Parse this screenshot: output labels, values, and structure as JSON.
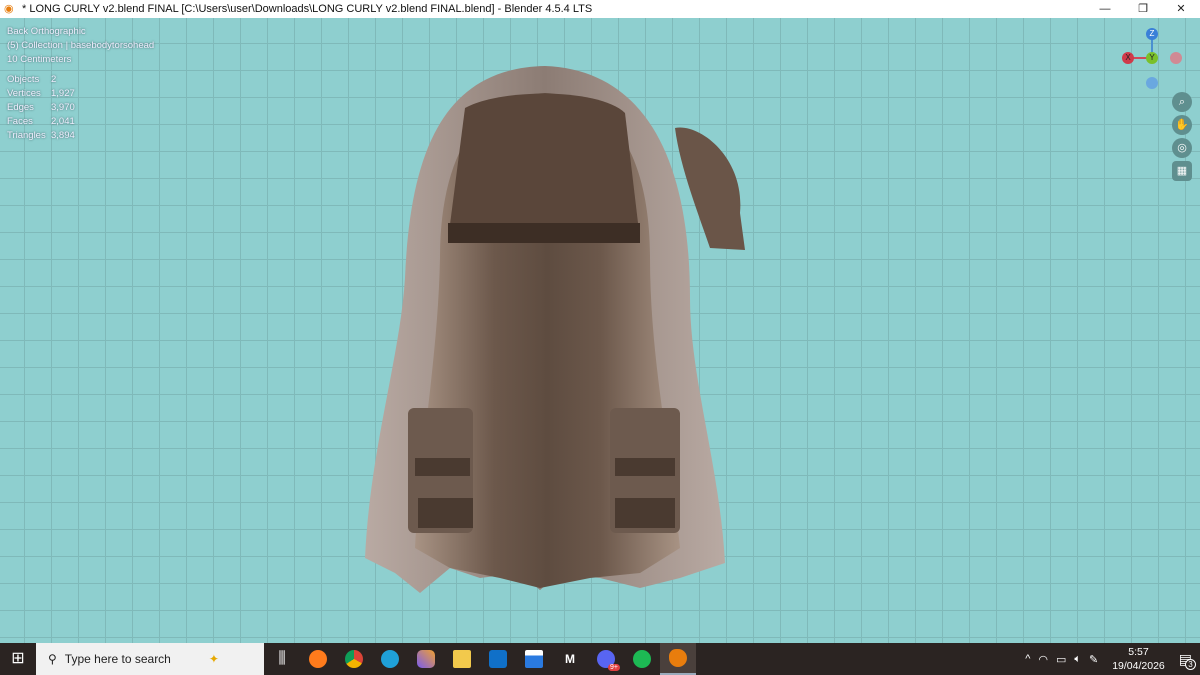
{
  "window": {
    "title": "* LONG CURLY v2.blend FINAL [C:\\Users\\user\\Downloads\\LONG CURLY v2.blend FINAL.blend] - Blender 4.5.4 LTS",
    "minimize": "—",
    "restore": "❐",
    "close": "✕"
  },
  "overlay": {
    "view": "Back Orthographic",
    "collection": "(5) Collection | basebodytorsohead",
    "scale": "10 Centimeters",
    "stats": [
      {
        "label": "Objects",
        "value": "2"
      },
      {
        "label": "Vertices",
        "value": "1,927"
      },
      {
        "label": "Edges",
        "value": "3,970"
      },
      {
        "label": "Faces",
        "value": "2,041"
      },
      {
        "label": "Triangles",
        "value": "3,894"
      }
    ]
  },
  "gizmo": {
    "z": "Z",
    "x": "X",
    "y": "Y"
  },
  "colors": {
    "viewport": "#8ecfcf",
    "grid": "#7fb9b9",
    "hair": "#7a6659",
    "taskbar": "#2b2422"
  },
  "taskbar": {
    "search_placeholder": "Type here to search",
    "discord_badge": "9+",
    "time": "5:57",
    "date": "19/04/2026",
    "notifications": "3"
  }
}
